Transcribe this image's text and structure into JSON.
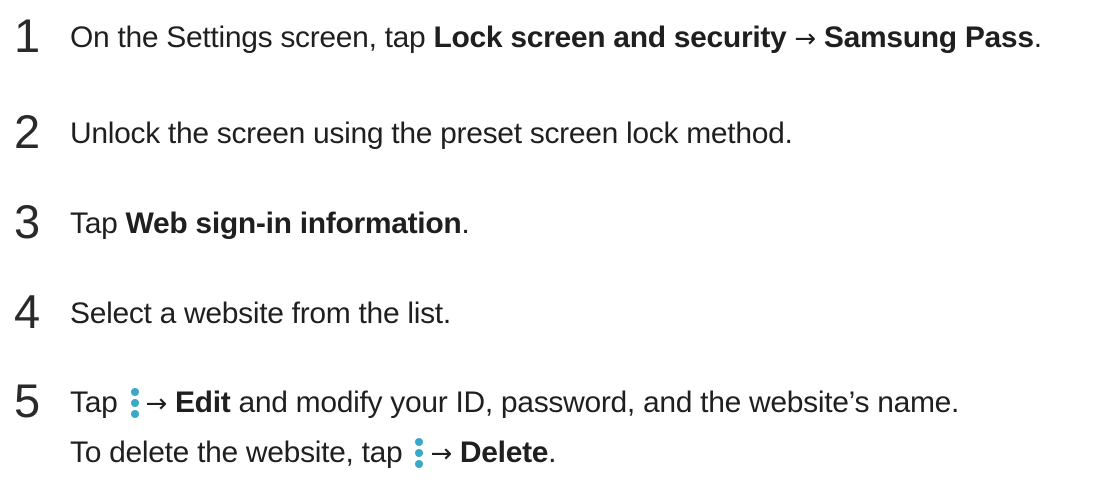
{
  "steps": [
    {
      "number": "1",
      "pre": "On the Settings screen, tap ",
      "bold1": "Lock screen and security",
      "arrow": " → ",
      "bold2": "Samsung Pass",
      "post": "."
    },
    {
      "number": "2",
      "text": "Unlock the screen using the preset screen lock method."
    },
    {
      "number": "3",
      "pre": "Tap ",
      "bold": "Web sign-in information",
      "post": "."
    },
    {
      "number": "4",
      "text": "Select a website from the list."
    },
    {
      "number": "5",
      "pre": "Tap ",
      "icon": "more-options-icon",
      "arrow": "→ ",
      "bold": "Edit",
      "post": " and modify your ID, password, and the website’s name.",
      "note_pre": "To delete the website, tap ",
      "note_icon": "more-options-icon",
      "note_arrow": "→ ",
      "note_bold": "Delete",
      "note_post": "."
    }
  ],
  "colors": {
    "text": "#1f1f1f",
    "icon_accent": "#3aa9c8"
  }
}
